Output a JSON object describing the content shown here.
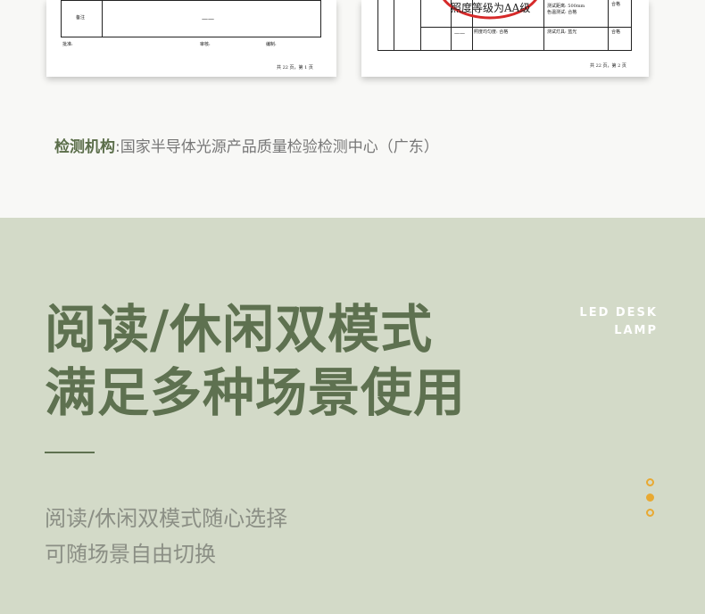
{
  "documents": {
    "page1": {
      "remark_label": "备注",
      "remark_value": "——",
      "approve_label": "批准:",
      "review_label": "审核:",
      "compile_label": "编制:",
      "page_footer": "共 22 页，第 1 页"
    },
    "page2": {
      "stamp_text": "照度等级为AA级",
      "cell_dash": "——",
      "cell_text_1": "测试距离: 500mm",
      "cell_text_2": "照度均匀度: 合格",
      "cell_text_3": "色温测试: 合格",
      "cell_text_4": "测试灯具: 蓝光",
      "result_1": "合格",
      "result_2": "合格",
      "page_footer": "共 22 页，第 2 页"
    }
  },
  "testing_org": {
    "label": "检测机构",
    "separator": ":",
    "value": "国家半导体光源产品质量检验检测中心（广东）"
  },
  "feature": {
    "headline_line1": "阅读/休闲双模式",
    "headline_line2": "满足多种场景使用",
    "brand_line1": "LED DESK",
    "brand_line2": "LAMP",
    "desc_line1": "阅读/休闲双模式随心选择",
    "desc_line2": "可随场景自由切换"
  },
  "colors": {
    "accent_green": "#5e7150",
    "panel_bg": "#d3dac8",
    "dot_color": "#e8a932",
    "stamp_red": "#d62a2a"
  }
}
